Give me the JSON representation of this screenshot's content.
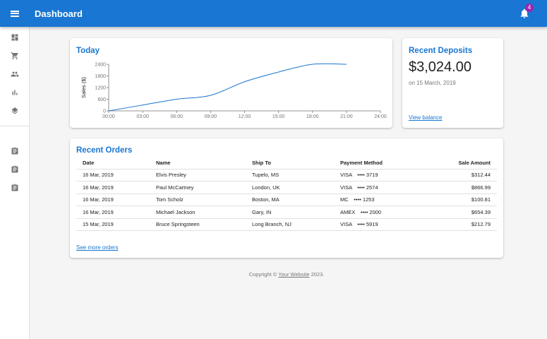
{
  "appbar": {
    "title": "Dashboard",
    "notification_count": "4"
  },
  "sidebar": {
    "items": [
      "dashboard",
      "cart",
      "people",
      "bar-chart",
      "layers",
      "assignment",
      "assignment",
      "assignment"
    ]
  },
  "today_card": {
    "title": "Today",
    "chart_data": {
      "type": "line",
      "xlabel": "",
      "ylabel": "Sales ($)",
      "x": [
        "00:00",
        "03:00",
        "06:00",
        "09:00",
        "12:00",
        "15:00",
        "18:00",
        "21:00",
        "24:00"
      ],
      "x_ticks": [
        "00:00",
        "03:00",
        "06:00",
        "09:00",
        "12:00",
        "15:00",
        "18:00",
        "21:00",
        "24:00"
      ],
      "y_ticks": [
        0,
        600,
        1200,
        1800,
        2400
      ],
      "ylim": [
        0,
        2400
      ],
      "series": [
        {
          "values": [
            0,
            300,
            600,
            800,
            1500,
            2000,
            2400,
            2400,
            null
          ]
        }
      ],
      "color": "#1976d2"
    }
  },
  "deposits_card": {
    "title": "Recent Deposits",
    "amount": "$3,024.00",
    "date": "on 15 March, 2019",
    "link": "View balance"
  },
  "orders_card": {
    "title": "Recent Orders",
    "columns": [
      "Date",
      "Name",
      "Ship To",
      "Payment Method",
      "Sale Amount"
    ],
    "rows": [
      [
        "16 Mar, 2019",
        "Elvis Presley",
        "Tupelo, MS",
        "VISA ⠀•••• 3719",
        "$312.44"
      ],
      [
        "16 Mar, 2019",
        "Paul McCartney",
        "London, UK",
        "VISA ⠀•••• 2574",
        "$866.99"
      ],
      [
        "16 Mar, 2019",
        "Tom Scholz",
        "Boston, MA",
        "MC ⠀•••• 1253",
        "$100.81"
      ],
      [
        "16 Mar, 2019",
        "Michael Jackson",
        "Gary, IN",
        "AMEX ⠀•••• 2000",
        "$654.39"
      ],
      [
        "15 Mar, 2019",
        "Bruce Springsteen",
        "Long Branch, NJ",
        "VISA ⠀•••• 5919",
        "$212.79"
      ]
    ],
    "link": "See more orders"
  },
  "footer": {
    "prefix": "Copyright © ",
    "link": "Your Website",
    "suffix": " 2023."
  }
}
